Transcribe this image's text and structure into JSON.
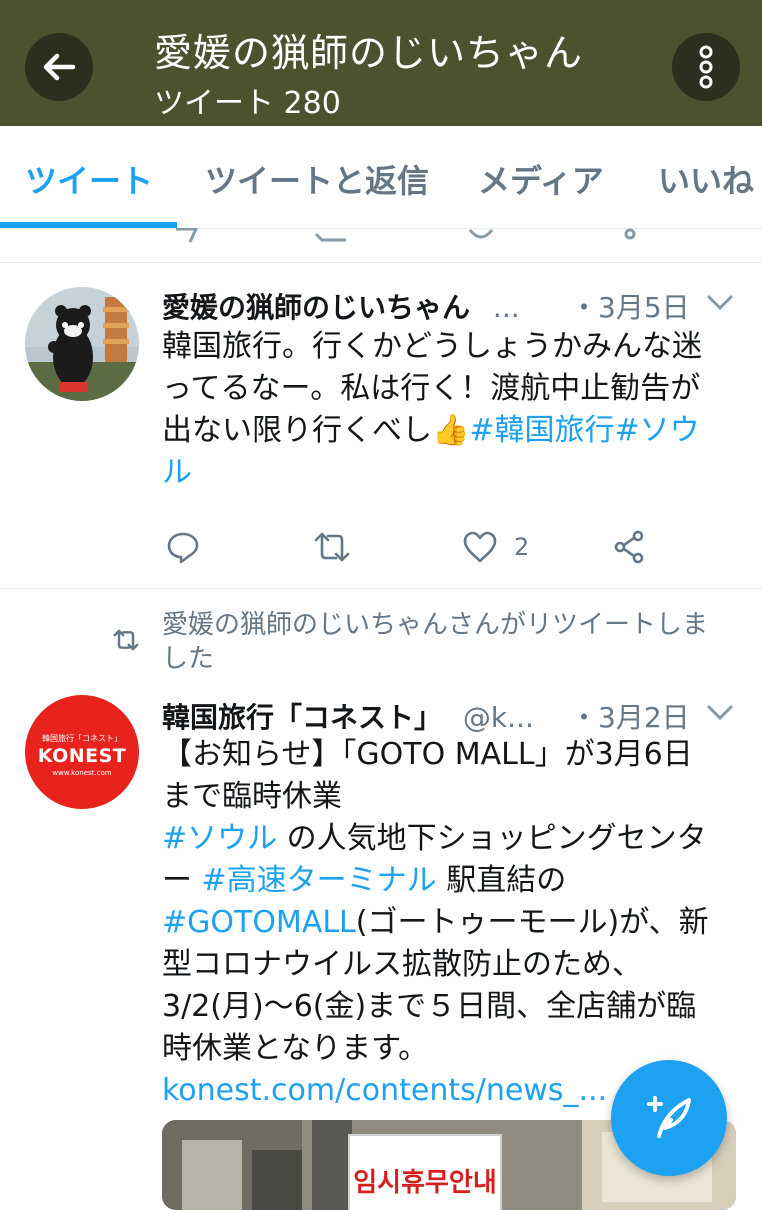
{
  "header": {
    "title": "愛媛の猟師のじいちゃん",
    "subtitle": "ツイート 280",
    "back_icon": "arrow-left-icon",
    "more_icon": "more-vertical-icon"
  },
  "tabs": [
    {
      "label": "ツイート",
      "active": true
    },
    {
      "label": "ツイートと返信",
      "active": false
    },
    {
      "label": "メディア",
      "active": false
    },
    {
      "label": "いいね",
      "active": false
    }
  ],
  "tweet1": {
    "name": "愛媛の猟師のじいちゃん",
    "handle_ellipsis": "...",
    "date": "・3月5日",
    "text_lines": [
      "韓国旅行。行くかどうしょうかみんな迷",
      "ってるなー。私は行く！渡航中止勧告が",
      "出ない限り行くべし"
    ],
    "emoji": "👍",
    "hashtags": [
      "#韓国旅行",
      "#ソウ"
    ],
    "text_last": "ル",
    "like_count": "2"
  },
  "retweet_notice": "愛媛の猟師のじいちゃんさんがリツイートしました",
  "tweet2": {
    "name": "韓国旅行「コネスト」",
    "handle": "@k...",
    "date": "・3月2日",
    "avatar_brand": "KONEST",
    "avatar_top": "韓国旅行「コネスト」",
    "avatar_url": "www.konest.com",
    "line1": "【お知らせ】「GOTO MALL」が3月6日",
    "line2": "まで臨時休業",
    "line3_tag": "#ソウル",
    "line3_rest": " の人気地下ショッピングセンタ",
    "line4_pre": "ー ",
    "line4_tag": "#高速ターミナル",
    "line4_rest": " 駅直結の",
    "line5_tag": "#GOTOMALL",
    "line5_rest": "(ゴートゥーモール)が、新",
    "line6": "型コロナウイルス拡散防止のため、",
    "line7": "3/2(月)〜6(金)まで５日間、全店舗が臨",
    "line8": "時休業となります。",
    "link": "konest.com/contents/news_...",
    "media_sign": "임시휴무안내"
  },
  "colors": {
    "header_bg": "#4a5230",
    "accent": "#1da1f2",
    "secondary_text": "#657786",
    "konest_red": "#e8231d"
  }
}
